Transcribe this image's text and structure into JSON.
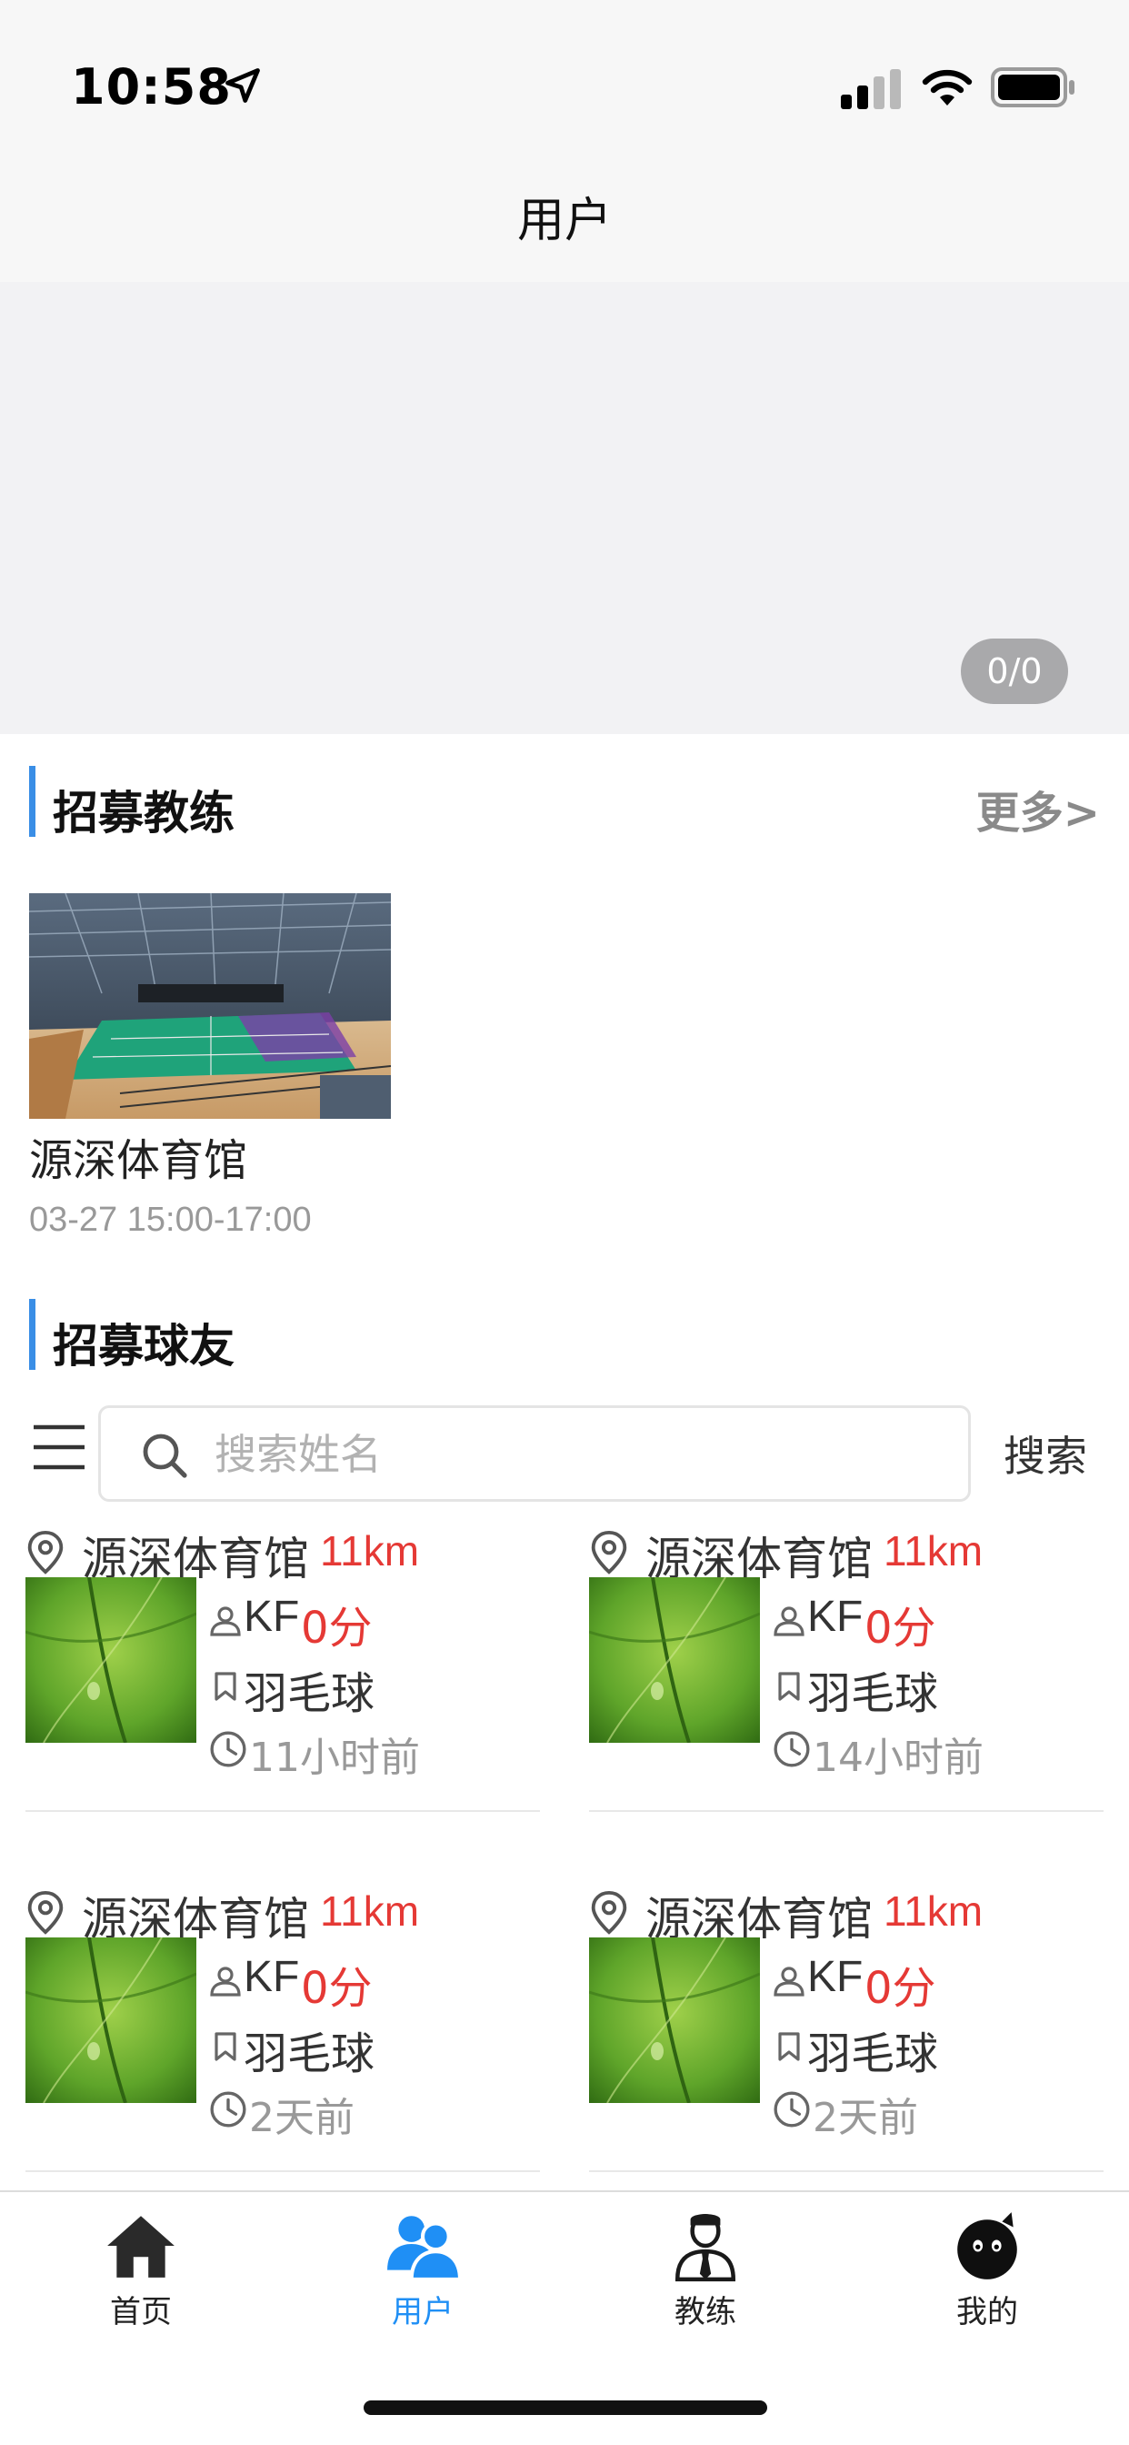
{
  "status_bar": {
    "time": "10:58"
  },
  "nav": {
    "title": "用户"
  },
  "banner": {
    "counter": "0/0"
  },
  "coach_section": {
    "title": "招募教练",
    "more": "更多>",
    "cards": [
      {
        "venue": "源深体育馆",
        "time": "03-27 15:00-17:00"
      }
    ]
  },
  "partner_section": {
    "title": "招募球友",
    "search": {
      "placeholder": "搜索姓名",
      "value": "",
      "button": "搜索"
    },
    "items": [
      {
        "venue": "源深体育馆",
        "distance": "11km",
        "user": "KF",
        "score": "0分",
        "sport": "羽毛球",
        "ago": "11小时前"
      },
      {
        "venue": "源深体育馆",
        "distance": "11km",
        "user": "KF",
        "score": "0分",
        "sport": "羽毛球",
        "ago": "14小时前"
      },
      {
        "venue": "源深体育馆",
        "distance": "11km",
        "user": "KF",
        "score": "0分",
        "sport": "羽毛球",
        "ago": "2天前"
      },
      {
        "venue": "源深体育馆",
        "distance": "11km",
        "user": "KF",
        "score": "0分",
        "sport": "羽毛球",
        "ago": "2天前"
      }
    ]
  },
  "tabbar": {
    "tabs": [
      {
        "label": "首页",
        "icon": "home-icon",
        "active": false
      },
      {
        "label": "用户",
        "icon": "users-icon",
        "active": true
      },
      {
        "label": "教练",
        "icon": "coach-icon",
        "active": false
      },
      {
        "label": "我的",
        "icon": "profile-icon",
        "active": false
      }
    ]
  },
  "colors": {
    "accent": "#1f8ff5",
    "section_bar": "#3a8ee6",
    "highlight": "#e53935",
    "muted": "#999999"
  }
}
